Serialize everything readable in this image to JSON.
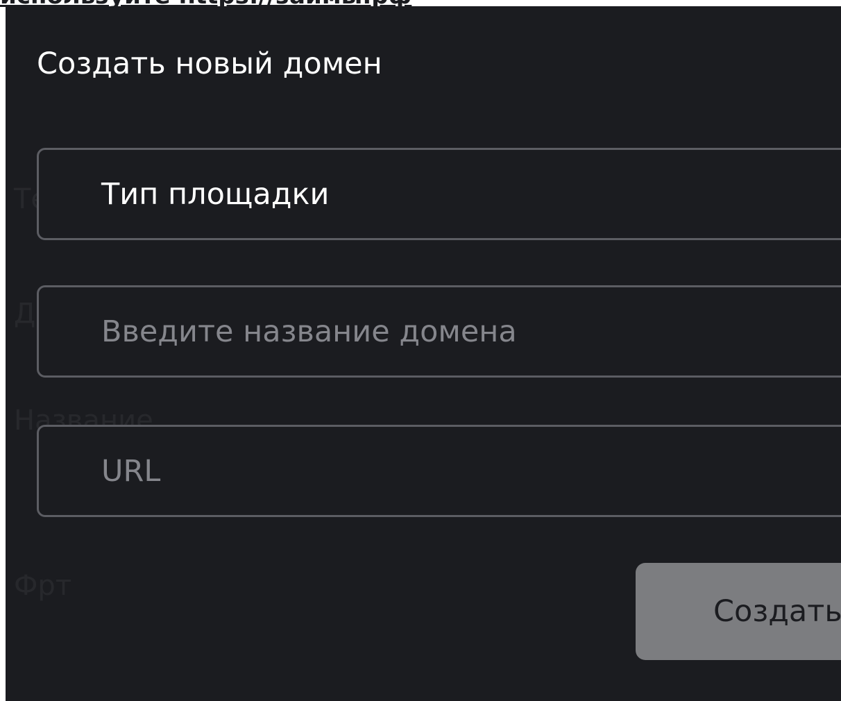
{
  "background_hint": "используйте https://займы.рф",
  "modal": {
    "title": "Создать новый домен",
    "platform_type": {
      "value": "Тип площадки",
      "icon": "chevron-down-icon"
    },
    "domain_name": {
      "value": "",
      "placeholder": "Введите название домена"
    },
    "url": {
      "value": "",
      "placeholder": "URL"
    },
    "create_button": {
      "label": "Создать",
      "state": "disabled"
    }
  },
  "colors": {
    "modal_background": "#1b1c20",
    "field_border": "#5c5d63",
    "text_primary": "#ffffff",
    "text_placeholder": "#85868c",
    "button_disabled_background": "#7c7d80",
    "button_disabled_text": "#1b1c20"
  }
}
